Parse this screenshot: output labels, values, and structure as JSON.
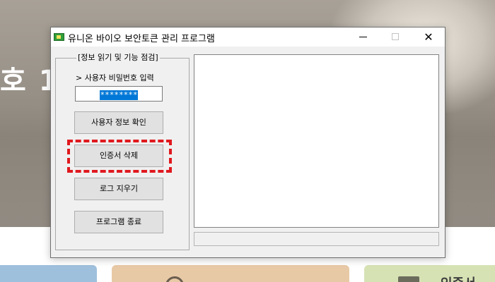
{
  "background": {
    "heading": "호 1",
    "card_text": "인증서 "
  },
  "window": {
    "title": "유니온 바이오 보안토큰 관리 프로그램",
    "minimize_label": "—",
    "close_label": "✕"
  },
  "group": {
    "title": "[정보 읽기 및 기능 점검]",
    "password_label": "> 사용자 비밀번호 입력",
    "password_value": "********"
  },
  "buttons": {
    "user_info": "사용자 정보 확인",
    "delete_cert": "인증서 삭제",
    "clear_log": "로그 지우기",
    "exit": "프로그램 종료"
  },
  "output": {
    "log_text": "",
    "status_text": ""
  },
  "colors": {
    "highlight": "#e0191e",
    "selection": "#0078d7"
  },
  "icons": {
    "app": "token-app-icon",
    "minimize": "minimize-icon",
    "maximize": "maximize-icon",
    "close": "close-icon"
  }
}
